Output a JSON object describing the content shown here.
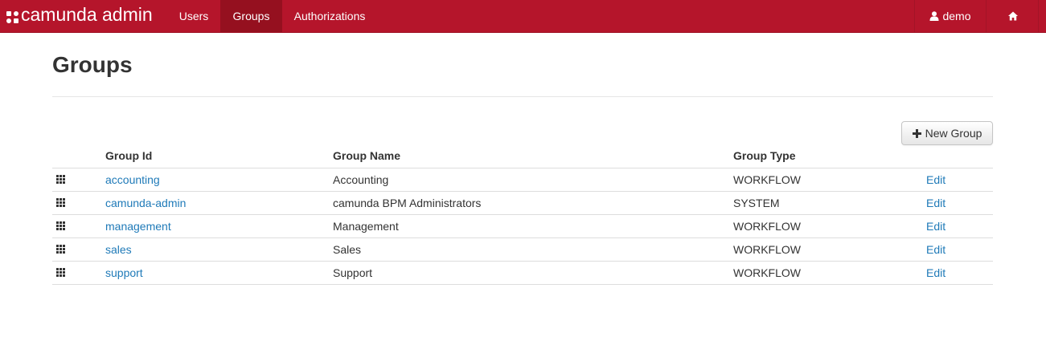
{
  "brand": {
    "text": "camunda admin"
  },
  "nav": {
    "items": [
      {
        "label": "Users"
      },
      {
        "label": "Groups"
      },
      {
        "label": "Authorizations"
      }
    ],
    "user": {
      "label": "demo",
      "icon": "user-icon"
    },
    "home": {
      "icon": "home-icon"
    }
  },
  "colors": {
    "navbar": "#b5152b",
    "navbar_active": "#95101f",
    "link": "#1f7ab8"
  },
  "page": {
    "title": "Groups"
  },
  "toolbar": {
    "new_group_label": "New Group",
    "new_group_icon": "plus-icon"
  },
  "table": {
    "headers": {
      "id": "Group Id",
      "name": "Group Name",
      "type": "Group Type"
    },
    "rows": [
      {
        "id": "accounting",
        "name": "Accounting",
        "type": "WORKFLOW",
        "action": "Edit"
      },
      {
        "id": "camunda-admin",
        "name": "camunda BPM Administrators",
        "type": "SYSTEM",
        "action": "Edit"
      },
      {
        "id": "management",
        "name": "Management",
        "type": "WORKFLOW",
        "action": "Edit"
      },
      {
        "id": "sales",
        "name": "Sales",
        "type": "WORKFLOW",
        "action": "Edit"
      },
      {
        "id": "support",
        "name": "Support",
        "type": "WORKFLOW",
        "action": "Edit"
      }
    ]
  }
}
